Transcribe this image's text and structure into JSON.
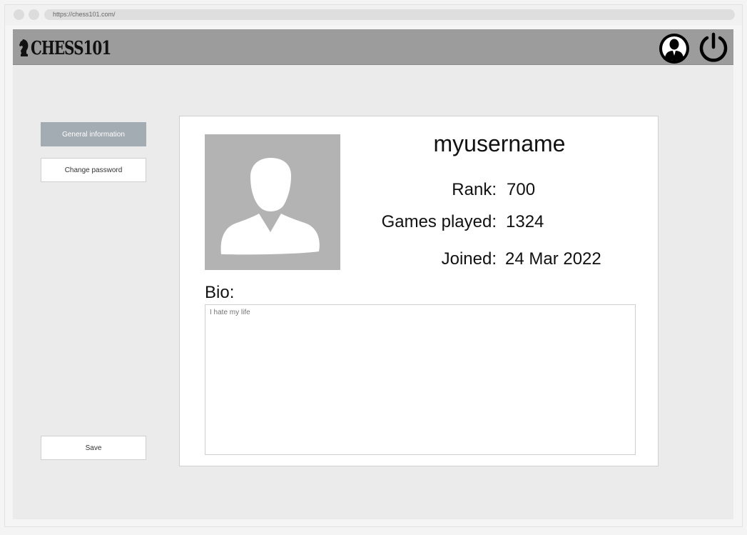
{
  "browser": {
    "url": "https://chess101.com/"
  },
  "header": {
    "logo_text": "CHESS101",
    "profile_icon": "profile-icon",
    "power_icon": "power-icon"
  },
  "sidebar": {
    "items": [
      {
        "label": "General information",
        "active": true
      },
      {
        "label": "Change password",
        "active": false
      }
    ],
    "save_label": "Save"
  },
  "profile": {
    "username": "myusername",
    "stats": [
      {
        "label": "Rank:",
        "value": "700"
      },
      {
        "label": "Games played:",
        "value": "1324"
      },
      {
        "label": "Joined:",
        "value": "24 Mar 2022"
      }
    ],
    "bio_label": "Bio:",
    "bio_placeholder": "I hate my life"
  },
  "colors": {
    "header_bg": "#9c9c9c",
    "active_button_bg": "#a3abb3",
    "avatar_bg": "#b3b3b3",
    "page_bg": "#ebebeb"
  }
}
